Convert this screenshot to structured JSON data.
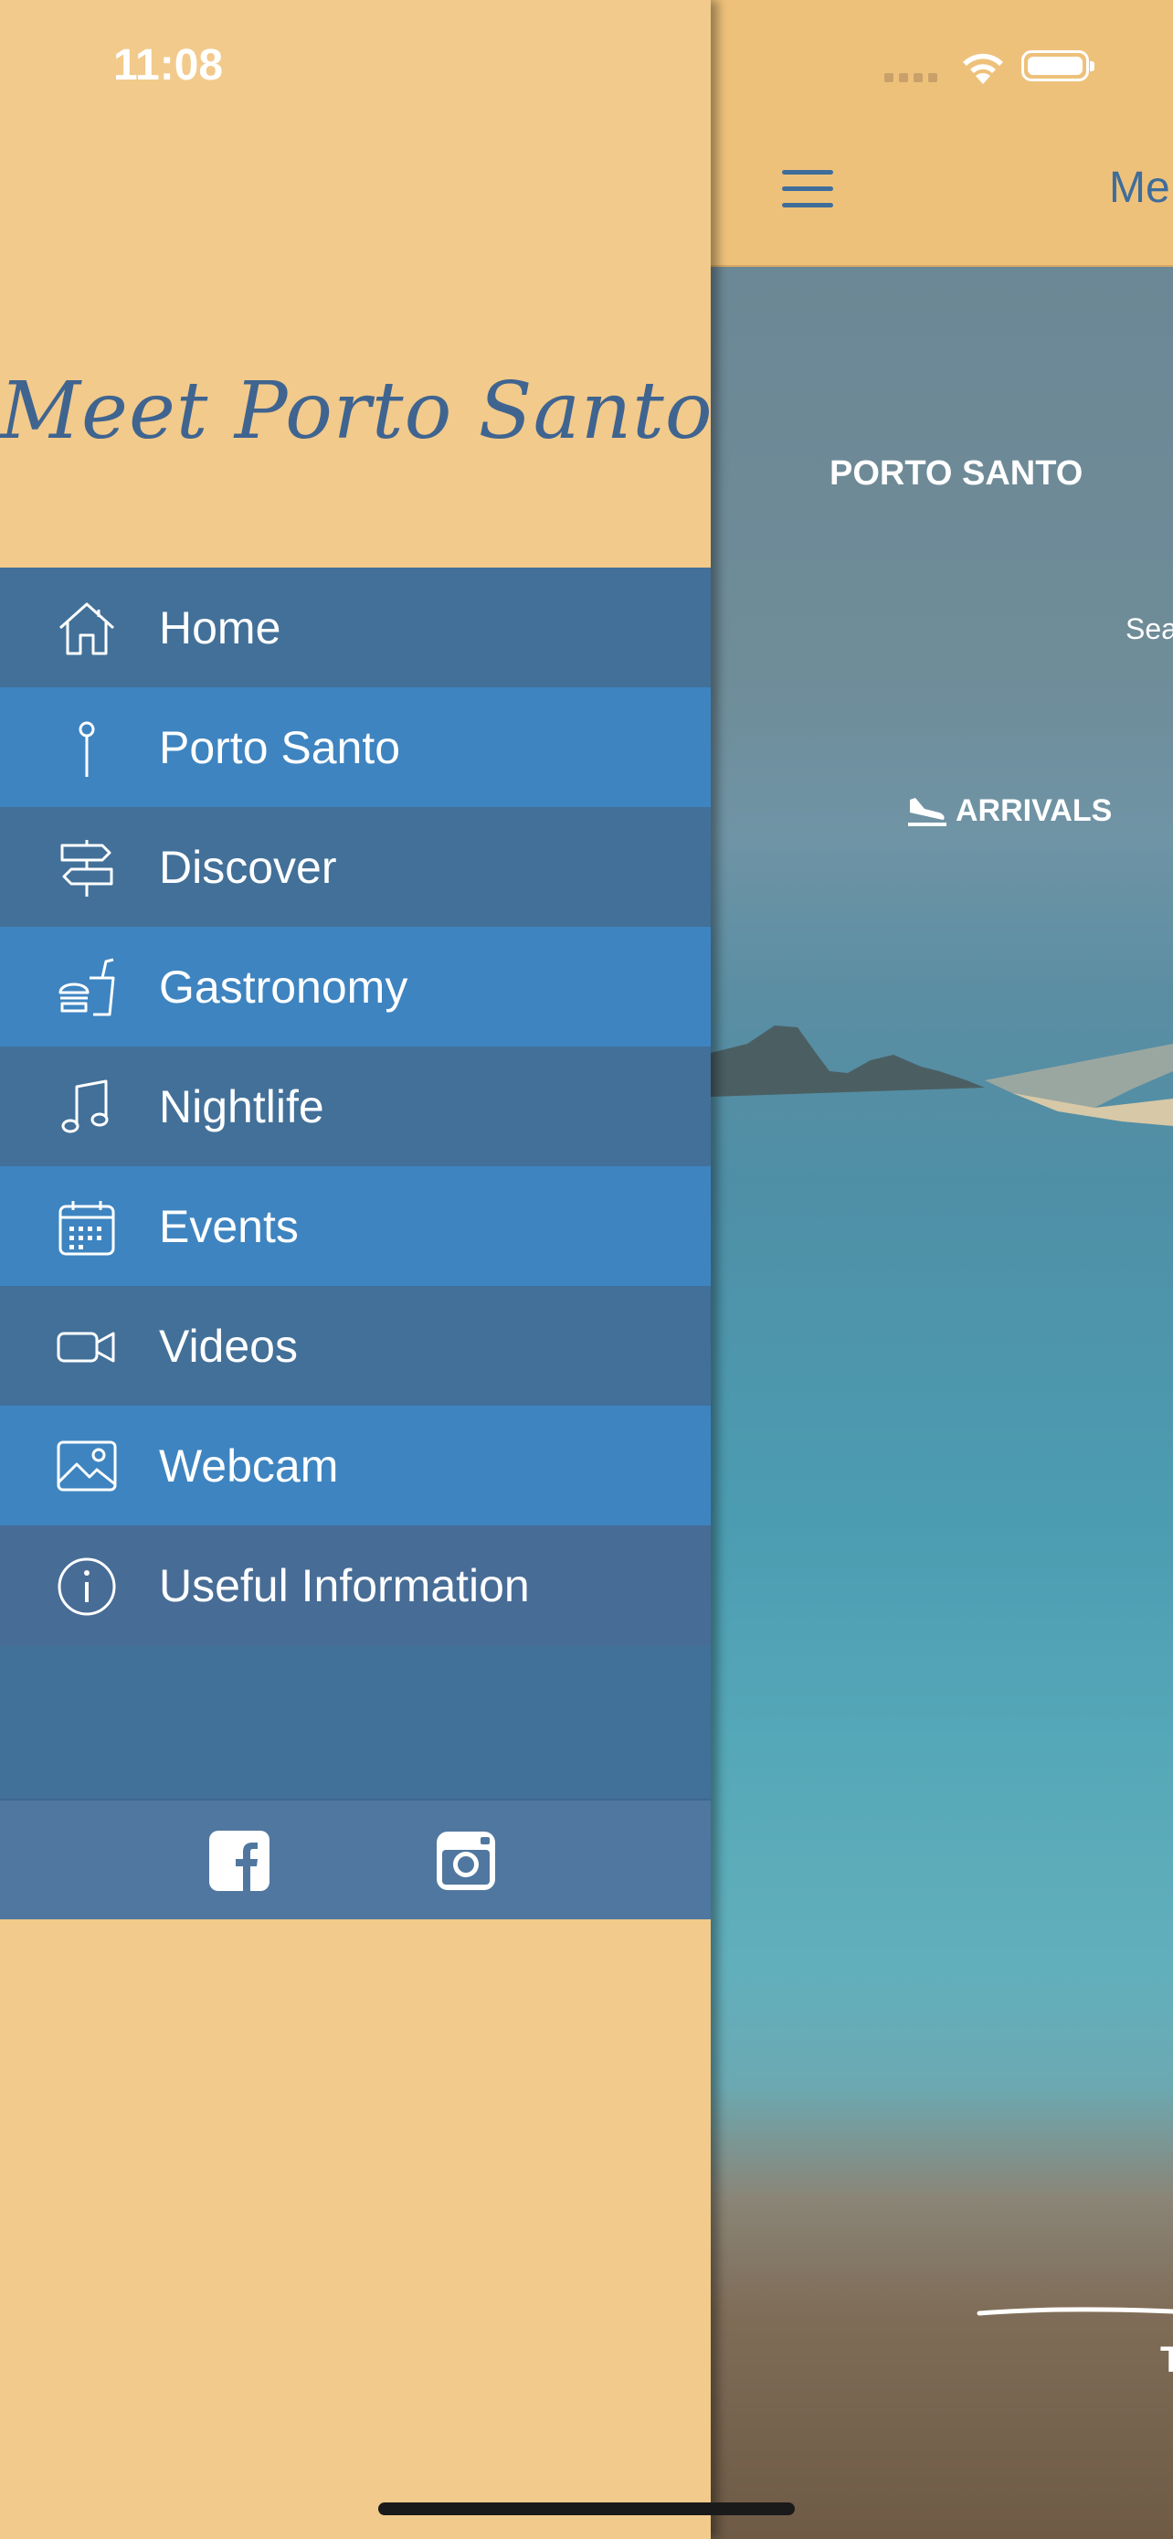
{
  "status_bar": {
    "time": "11:08"
  },
  "drawer": {
    "brand": "Meet Porto Santo",
    "menu": [
      {
        "label": "Home",
        "icon": "home-icon"
      },
      {
        "label": "Porto Santo",
        "icon": "map-pin-icon"
      },
      {
        "label": "Discover",
        "icon": "signpost-icon"
      },
      {
        "label": "Gastronomy",
        "icon": "burger-drink-icon"
      },
      {
        "label": "Nightlife",
        "icon": "music-note-icon"
      },
      {
        "label": "Events",
        "icon": "calendar-icon"
      },
      {
        "label": "Videos",
        "icon": "video-camera-icon"
      },
      {
        "label": "Webcam",
        "icon": "image-icon"
      },
      {
        "label": "Useful Information",
        "icon": "info-icon"
      }
    ],
    "social": [
      {
        "icon": "facebook-icon"
      },
      {
        "icon": "instagram-icon"
      }
    ]
  },
  "main": {
    "header_title": "Me",
    "hero_title": "PORTO SANTO",
    "hero_partial_text": "Sea",
    "arrivals_label": "ARRIVALS",
    "bottom_partial_text": "T"
  },
  "colors": {
    "drawer_bg": "#f2ca8b",
    "menu_dark": "#427099",
    "menu_light": "#3e84c0",
    "brand_text": "#3f6490"
  }
}
